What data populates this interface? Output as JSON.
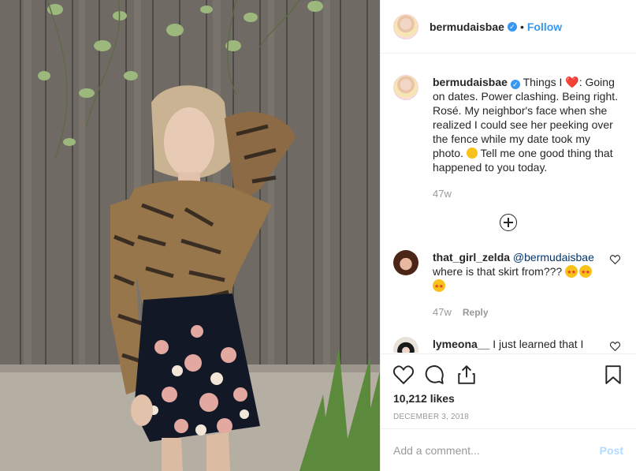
{
  "post": {
    "username": "bermudaisbae",
    "follow_label": "Follow",
    "separator": "•",
    "caption": {
      "before_heart": "Things I ",
      "heart": "❤️",
      "after_heart": ": Going on dates. Power clashing. Being right. Rosé. My neighbor's face when she realized I could see her peeking over the fence while my date took my photo. ",
      "after_emoji": " Tell me one good thing that happened to you today.",
      "age": "47w"
    },
    "comments": [
      {
        "username": "that_girl_zelda",
        "mention": "@bermudaisbae",
        "text": "where is that skirt from???",
        "age": "47w",
        "reply_label": "Reply"
      },
      {
        "username": "lymeona__",
        "text": "I just learned that I"
      }
    ],
    "likes": "10,212 likes",
    "date": "December 3, 2018",
    "add_comment_placeholder": "Add a comment...",
    "post_label": "Post"
  },
  "icons": {
    "verified": "verified-badge-icon",
    "like": "heart-icon",
    "comment": "comment-icon",
    "share": "share-icon",
    "save": "bookmark-icon",
    "load_more": "plus-circle-icon"
  },
  "colors": {
    "accent": "#3897f0",
    "muted": "#999999",
    "text": "#262626",
    "post_disabled": "#b3dbff"
  }
}
